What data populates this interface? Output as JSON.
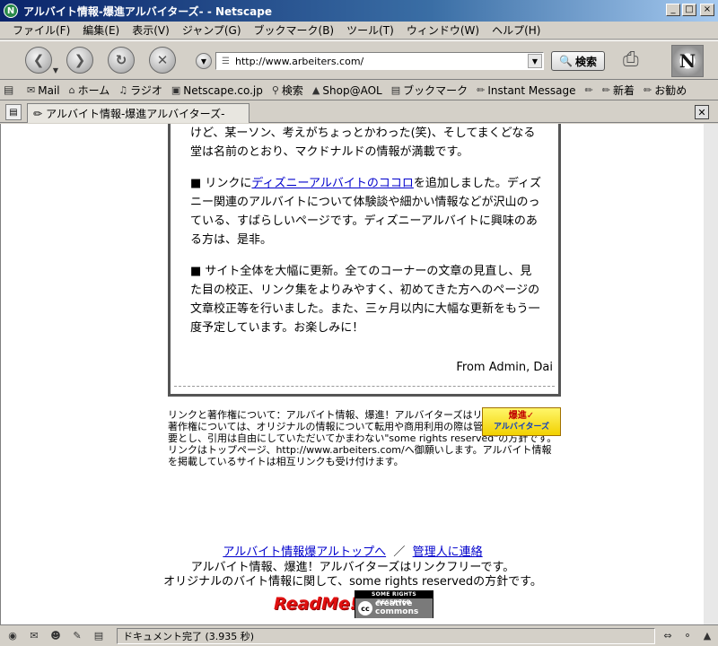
{
  "window": {
    "title": "アルバイト情報-爆進アルバイターズ- - Netscape",
    "app_icon": "N",
    "controls": [
      "_",
      "□",
      "×"
    ]
  },
  "menu": [
    "ファイル(F)",
    "編集(E)",
    "表示(V)",
    "ジャンプ(G)",
    "ブックマーク(B)",
    "ツール(T)",
    "ウィンドウ(W)",
    "ヘルプ(H)"
  ],
  "navbar": {
    "url": "http://www.arbeiters.com/",
    "search_label": "検索"
  },
  "personal_bar": {
    "items": [
      "Mail",
      "ホーム",
      "ラジオ",
      "Netscape.co.jp",
      "検索",
      "Shop@AOL",
      "ブックマーク",
      "Instant Message",
      "新着",
      "お勧め"
    ],
    "icons": [
      "mail-icon",
      "home-icon",
      "radio-icon",
      "netscape-icon",
      "search-icon",
      "shop-icon",
      "bookmark-icon",
      "im-icon",
      "new-icon",
      "recommend-icon"
    ]
  },
  "tab": {
    "label": "アルバイト情報-爆進アルバイターズ-"
  },
  "news": {
    "para1": "けど、某ーソン、考えがちょっとかわった(笑)、そしてまくどなる堂は名前のとおり、マクドナルドの情報が満載です。",
    "para2_prefix": "■ リンクに",
    "para2_link": "ディズニーアルバイトのココロ",
    "para2_suffix": "を追加しました。ディズニー関連のアルバイトについて体験談や細かい情報などが沢山のっている、すばらしいページです。ディズニーアルバイトに興味のある方は、是非。",
    "para3": "■ サイト全体を大幅に更新。全てのコーナーの文章の見直し、見た目の校正、リンク集をよりみやすく、初めてきた方へのページの文章校正等を行いました。また、三ヶ月以内に大幅な更新をもう一度予定しています。お楽しみに！",
    "signature": "From Admin, Dai"
  },
  "link_info": {
    "text": "リンクと著作権について：アルバイト情報、爆進！アルバイターズはリンクフリーです。著作権については、オリジナルの情報について転用や商用利用の際は管理者の許諾を必要とし、引用は自由にしていただいてかまわない\"some rights reserved\"の方針です。リンクはトップページ、http://www.arbeiters.com/へ御願いします。アルバイト情報を掲載しているサイトは相互リンクも受け付けます。",
    "badge_main": "爆進✓",
    "badge_sub": "アルバイターズ"
  },
  "footer": {
    "link_top": "アルバイト情報爆アルトップへ",
    "separator": "／",
    "link_contact": "管理人に連絡",
    "line1": "アルバイト情報、爆進！アルバイターズはリンクフリーです。",
    "line2": "オリジナルのバイト情報に関して、some rights reservedの方針です。",
    "readme": "ReadMe!",
    "cc_top": "SOME RIGHTS RESERVED",
    "cc_logo": "cc",
    "cc_text1": "creative",
    "cc_text2": "commons"
  },
  "status": {
    "text": "ドキュメント完了 (3.935 秒)"
  }
}
